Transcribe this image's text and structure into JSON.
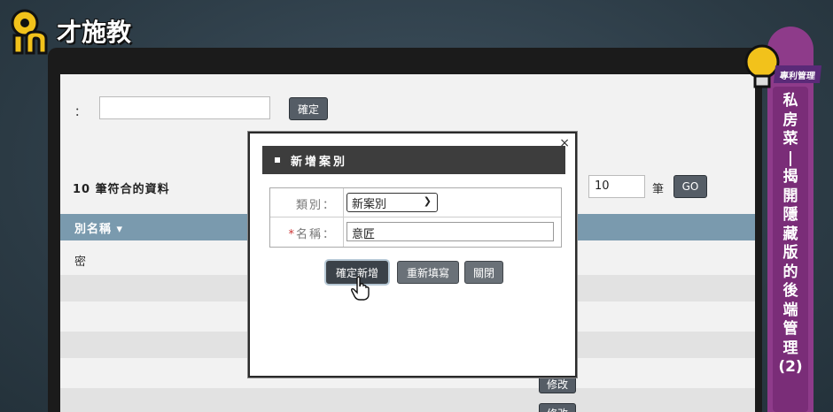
{
  "brand": {
    "name": "才施教",
    "mark": "in"
  },
  "search": {
    "label": "：",
    "value": "",
    "confirm_label": "確定"
  },
  "results": {
    "count_text": "10 筆符合的資料",
    "page_size": "10",
    "page_unit": "筆",
    "go_label": "GO"
  },
  "table": {
    "header": "別名稱 ▾",
    "rows": [
      "密",
      "",
      "",
      "",
      "",
      ""
    ],
    "edit_label": "修改",
    "edit_label_2": "修改"
  },
  "modal": {
    "close": "×",
    "title": "新增案別",
    "category_label": "類別：",
    "category_value": "新案別",
    "name_label": "名稱：",
    "name_required": "*",
    "name_value": "意匠",
    "buttons": {
      "add": "確定新增",
      "reset": "重新填寫",
      "close": "關閉"
    }
  },
  "side": {
    "tag": "專利管理",
    "title_chars": [
      "私",
      "房",
      "菜",
      "|",
      "揭",
      "開",
      "隱",
      "藏",
      "版",
      "的",
      "後",
      "端",
      "管",
      "理",
      "(2)"
    ]
  },
  "colors": {
    "accent": "#8e3b8a",
    "table_header": "#7a9aae",
    "modal_title": "#3d3d3d"
  }
}
